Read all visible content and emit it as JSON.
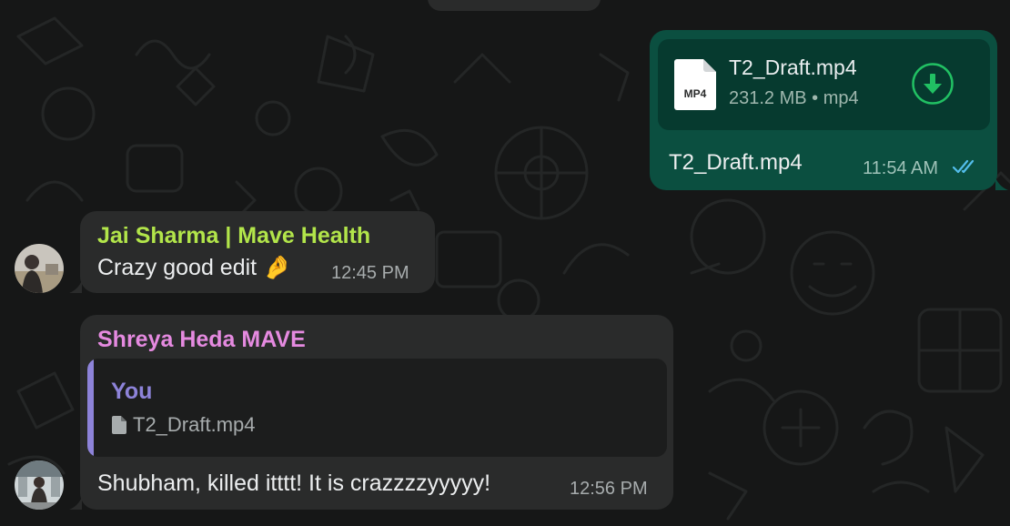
{
  "chat": {
    "messages": [
      {
        "direction": "outgoing",
        "attachment": {
          "icon": "mp4-file-icon",
          "ext": "MP4",
          "file_name": "T2_Draft.mp4",
          "meta": "231.2 MB • mp4",
          "action_icon": "download-icon"
        },
        "caption": "T2_Draft.mp4",
        "time": "11:54 AM",
        "status_icon": "double-check-read-icon"
      },
      {
        "direction": "incoming",
        "sender": "Jai Sharma | Mave Health",
        "sender_color": "#b2e54a",
        "text": "Crazy good edit 🤌",
        "time": "12:45 PM"
      },
      {
        "direction": "incoming",
        "sender": "Shreya Heda MAVE",
        "sender_color": "#e58ae0",
        "quote": {
          "author": "You",
          "icon": "file-icon",
          "file_name": "T2_Draft.mp4"
        },
        "text": "Shubham, killed itttt! It is crazzzzyyyyy!",
        "time": "12:56 PM"
      }
    ]
  },
  "colors": {
    "background": "#161717",
    "incoming_bubble": "#2a2b2b",
    "outgoing_bubble": "#0b4f40",
    "accent_green": "#21c063",
    "read_receipt": "#53bdeb",
    "quote_accent": "#8d83d9"
  }
}
